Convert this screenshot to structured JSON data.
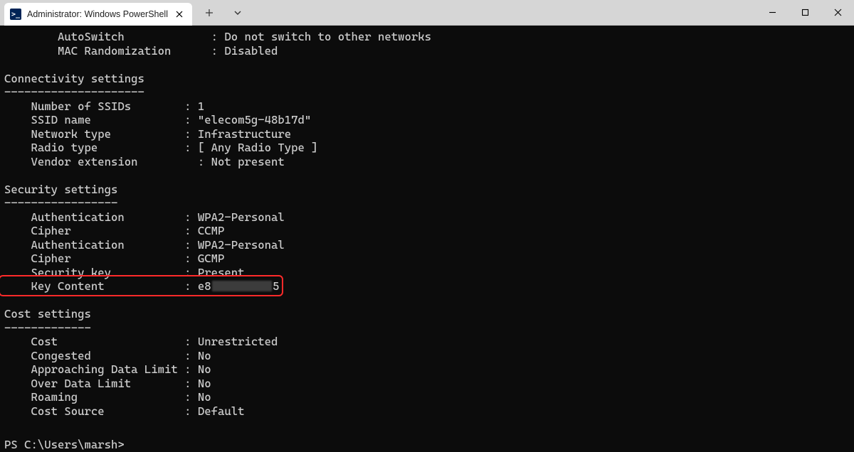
{
  "window": {
    "tab_title": "Administrator: Windows PowerShell",
    "icon_glyph": ">_"
  },
  "top_fields": [
    {
      "key": "AutoSwitch",
      "value": "Do not switch to other networks",
      "indent": 2
    },
    {
      "key": "MAC Randomization",
      "value": "Disabled",
      "indent": 2
    }
  ],
  "sections": [
    {
      "title": "Connectivity settings",
      "dash_count": 21,
      "rows": [
        {
          "key": "Number of SSIDs",
          "value": "1"
        },
        {
          "key": "SSID name",
          "value": "\"elecom5g-48b17d\""
        },
        {
          "key": "Network type",
          "value": "Infrastructure"
        },
        {
          "key": "Radio type",
          "value": "[ Any Radio Type ]"
        },
        {
          "key": "Vendor extension",
          "value": "Not present",
          "extra_sep_indent": true
        }
      ]
    },
    {
      "title": "Security settings",
      "dash_count": 17,
      "rows": [
        {
          "key": "Authentication",
          "value": "WPA2-Personal"
        },
        {
          "key": "Cipher",
          "value": "CCMP"
        },
        {
          "key": "Authentication",
          "value": "WPA2-Personal"
        },
        {
          "key": "Cipher",
          "value": "GCMP"
        },
        {
          "key": "Security key",
          "value": "Present"
        },
        {
          "key": "Key Content",
          "value_prefix": "e8",
          "value_suffix": "5",
          "redacted": true,
          "highlight": true
        }
      ]
    },
    {
      "title": "Cost settings",
      "dash_count": 13,
      "rows": [
        {
          "key": "Cost",
          "value": "Unrestricted"
        },
        {
          "key": "Congested",
          "value": "No"
        },
        {
          "key": "Approaching Data Limit",
          "value": "No"
        },
        {
          "key": "Over Data Limit",
          "value": "No"
        },
        {
          "key": "Roaming",
          "value": "No"
        },
        {
          "key": "Cost Source",
          "value": "Default"
        }
      ]
    }
  ],
  "prompt": "PS C:\\Users\\marsh>",
  "layout": {
    "key_col_width_ch": 22,
    "sep": " : "
  }
}
